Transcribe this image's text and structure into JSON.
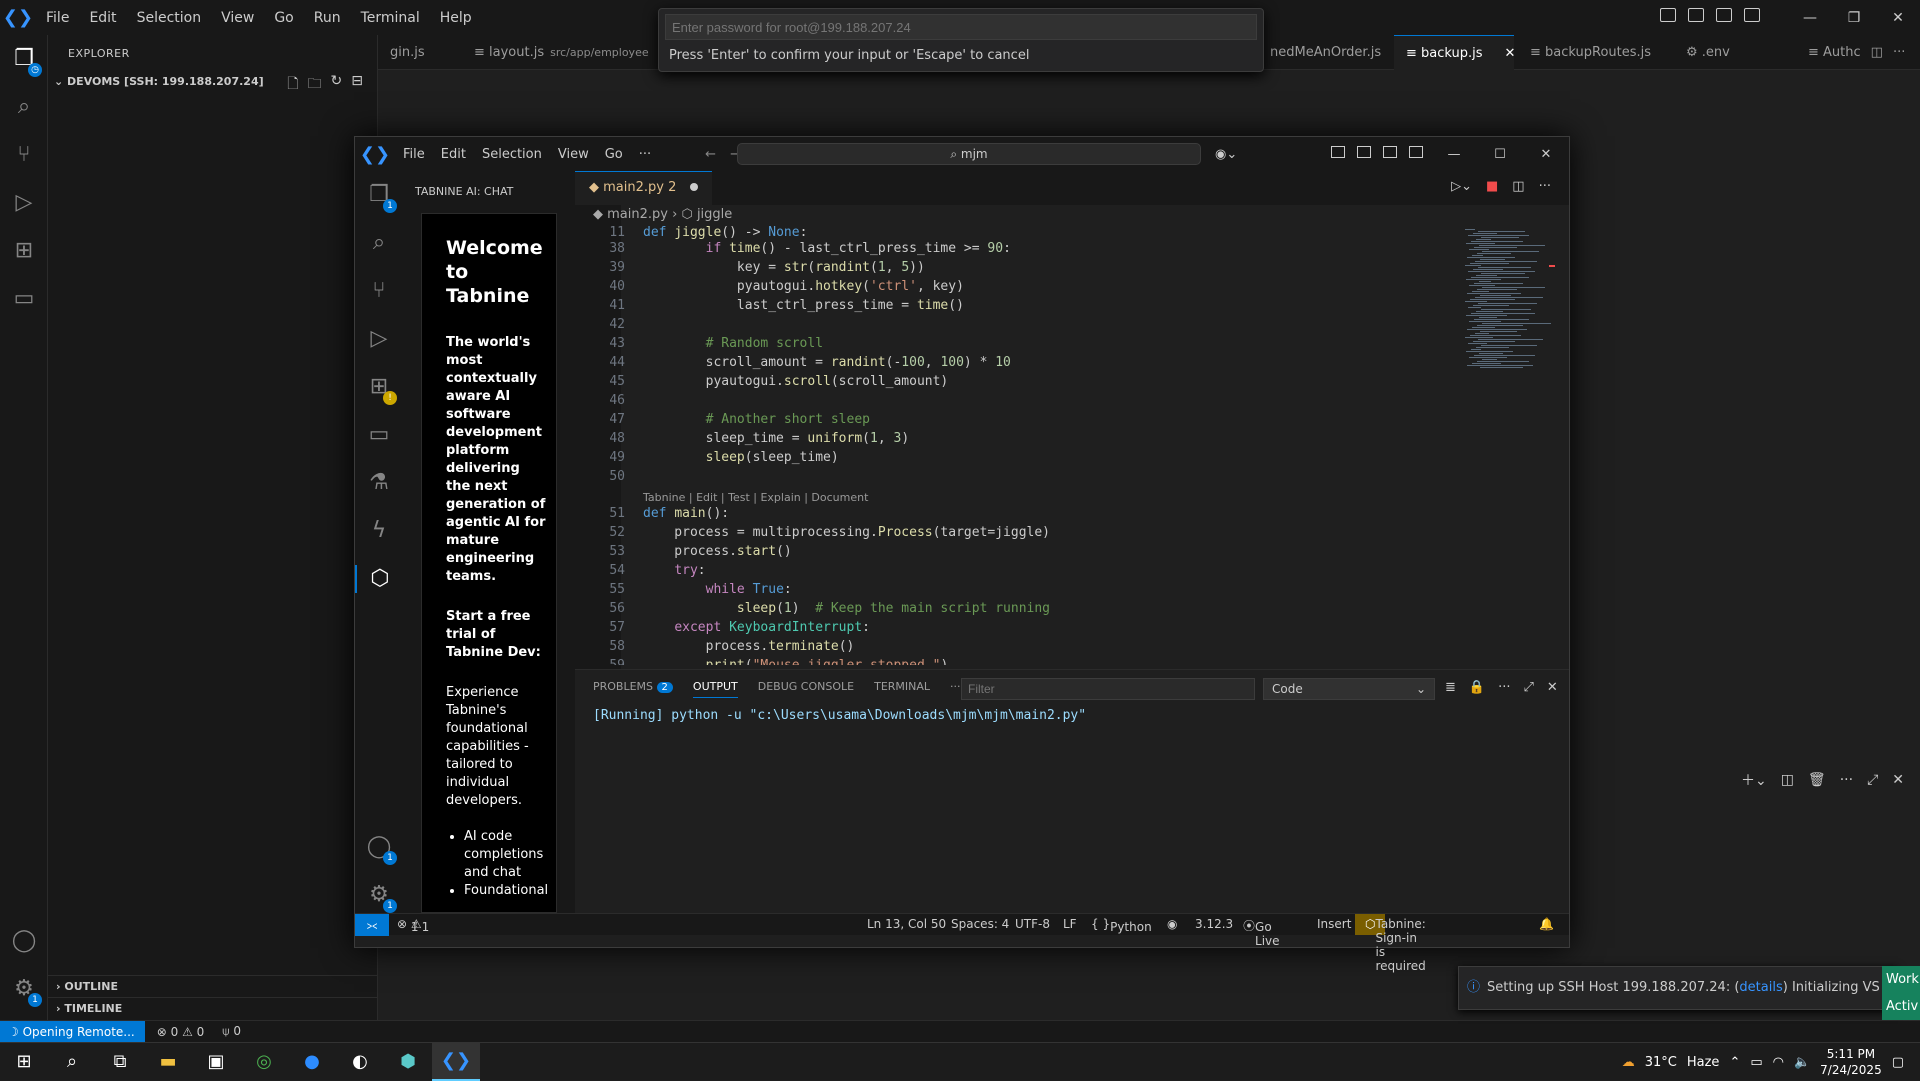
{
  "outer": {
    "menu": [
      "File",
      "Edit",
      "Selection",
      "View",
      "Go",
      "Run",
      "Terminal",
      "Help"
    ],
    "explorer_title": "EXPLORER",
    "workspace": "DEVOMS [SSH: 199.188.207.24]",
    "outline": "OUTLINE",
    "timeline": "TIMELINE",
    "tabs": [
      {
        "label": "gin.js"
      },
      {
        "label": "layout.js",
        "path": "src/app/employee"
      },
      {
        "label": "nedMeAnOrder.js"
      },
      {
        "label": "backup.js"
      },
      {
        "label": "backupRoutes.js"
      },
      {
        "label": ".env"
      },
      {
        "label": "Authc"
      }
    ],
    "status": {
      "remote": "Opening Remote...",
      "problems": "0",
      "warnings": "0",
      "ports": "0"
    }
  },
  "password_prompt": {
    "placeholder": "Enter password for root@199.188.207.24",
    "message": "Press 'Enter' to confirm your input or 'Escape' to cancel"
  },
  "inner": {
    "menu": [
      "File",
      "Edit",
      "Selection",
      "View",
      "Go"
    ],
    "more": "···",
    "search": "mjm",
    "side_title": "TABNINE AI: CHAT",
    "welcome": {
      "heading": "Welcome to Tabnine",
      "bold": "The world's most contextually aware AI software development platform delivering the next generation of agentic AI for mature engineering teams.",
      "trial": "Start a free trial of Tabnine Dev:",
      "para": "Experience Tabnine's foundational capabilities - tailored to individual developers.",
      "bullets": [
        "AI code completions and chat",
        "Foundational"
      ]
    },
    "tab": {
      "label": "main2.py",
      "count": "2"
    },
    "breadcrumb": {
      "file": "main2.py",
      "symbol": "jiggle"
    },
    "codelens": "Tabnine | Edit | Test | Explain | Document",
    "lines": [
      {
        "n": "11",
        "t": "def jiggle() -> None:"
      },
      {
        "n": "38",
        "t": "        if time() - last_ctrl_press_time >= 90:"
      },
      {
        "n": "39",
        "t": "            key = str(randint(1, 5))"
      },
      {
        "n": "40",
        "t": "            pyautogui.hotkey('ctrl', key)"
      },
      {
        "n": "41",
        "t": "            last_ctrl_press_time = time()"
      },
      {
        "n": "42",
        "t": ""
      },
      {
        "n": "43",
        "t": "        # Random scroll"
      },
      {
        "n": "44",
        "t": "        scroll_amount = randint(-100, 100) * 10"
      },
      {
        "n": "45",
        "t": "        pyautogui.scroll(scroll_amount)"
      },
      {
        "n": "46",
        "t": ""
      },
      {
        "n": "47",
        "t": "        # Another short sleep"
      },
      {
        "n": "48",
        "t": "        sleep_time = uniform(1, 3)"
      },
      {
        "n": "49",
        "t": "        sleep(sleep_time)"
      },
      {
        "n": "50",
        "t": ""
      },
      {
        "n": "51",
        "t": "def main():"
      },
      {
        "n": "52",
        "t": "    process = multiprocessing.Process(target=jiggle)"
      },
      {
        "n": "53",
        "t": "    process.start()"
      },
      {
        "n": "54",
        "t": "    try:"
      },
      {
        "n": "55",
        "t": "        while True:"
      },
      {
        "n": "56",
        "t": "            sleep(1)  # Keep the main script running"
      },
      {
        "n": "57",
        "t": "    except KeyboardInterrupt:"
      },
      {
        "n": "58",
        "t": "        process.terminate()"
      },
      {
        "n": "59",
        "t": "        print(\"Mouse jiggler stopped.\")"
      }
    ],
    "panel": {
      "tabs": [
        "PROBLEMS",
        "OUTPUT",
        "DEBUG CONSOLE",
        "TERMINAL"
      ],
      "problems_count": "2",
      "filter_placeholder": "Filter",
      "select": "Code",
      "output": "[Running] python -u \"c:\\Users\\usama\\Downloads\\mjm\\mjm\\main2.py\""
    },
    "status": {
      "errors": "1",
      "warnings": "1",
      "pos": "Ln 13, Col 50",
      "spaces": "Spaces: 4",
      "enc": "UTF-8",
      "eol": "LF",
      "lang": "Python",
      "ver": "3.12.3",
      "live": "Go Live",
      "mode": "Insert",
      "tabnine": "Tabnine: Sign-in is required"
    }
  },
  "toast": {
    "pre": "Setting up SSH Host 199.188.207.24: (",
    "link": "details",
    "post": ") Initializing VS Code Se"
  },
  "green": [
    "Work",
    "Activ"
  ],
  "taskbar": {
    "weather": "31°C",
    "weather_desc": "Haze",
    "time": "5:11 PM",
    "date": "7/24/2025"
  },
  "colors": {
    "accent": "#0078d4",
    "tabnine_warn": "#7a5e00",
    "bg": "#1f1f1f"
  }
}
